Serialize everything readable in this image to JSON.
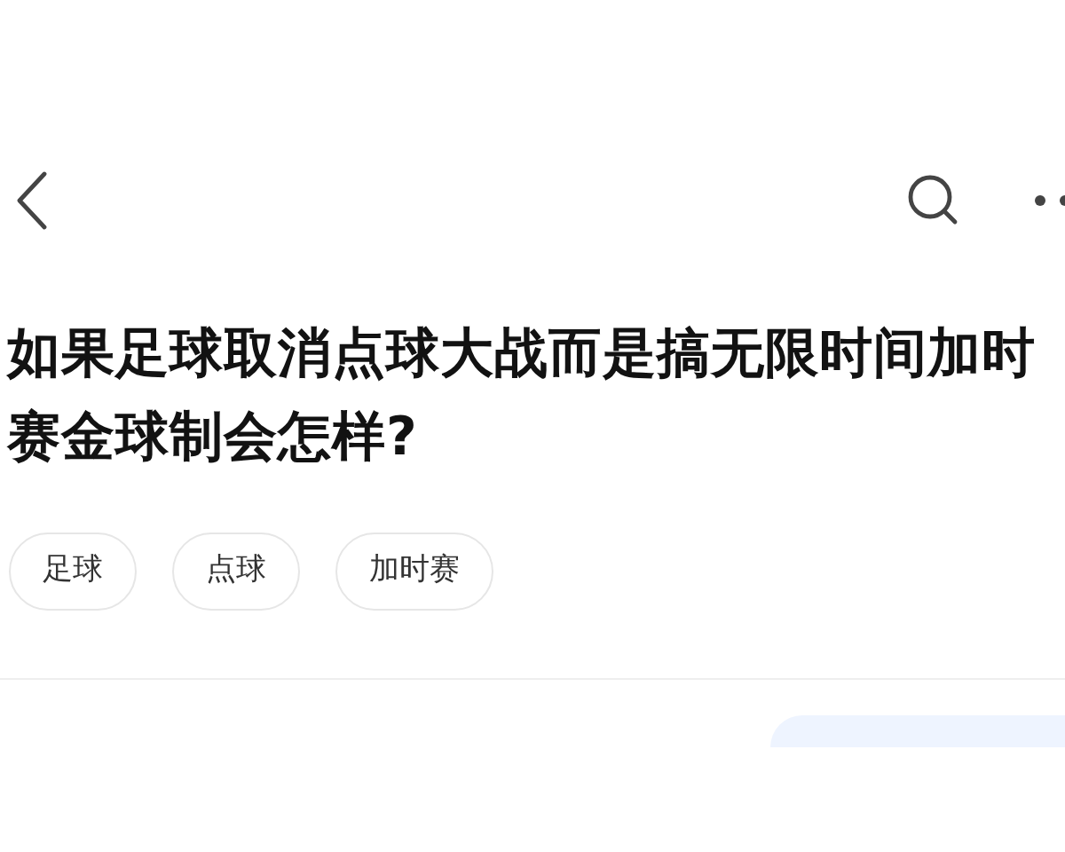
{
  "question": {
    "title": "如果足球取消点球大战而是搞无限时间加时赛金球制会怎样?"
  },
  "tags": [
    {
      "label": "足球"
    },
    {
      "label": "点球"
    },
    {
      "label": "加时赛"
    }
  ]
}
